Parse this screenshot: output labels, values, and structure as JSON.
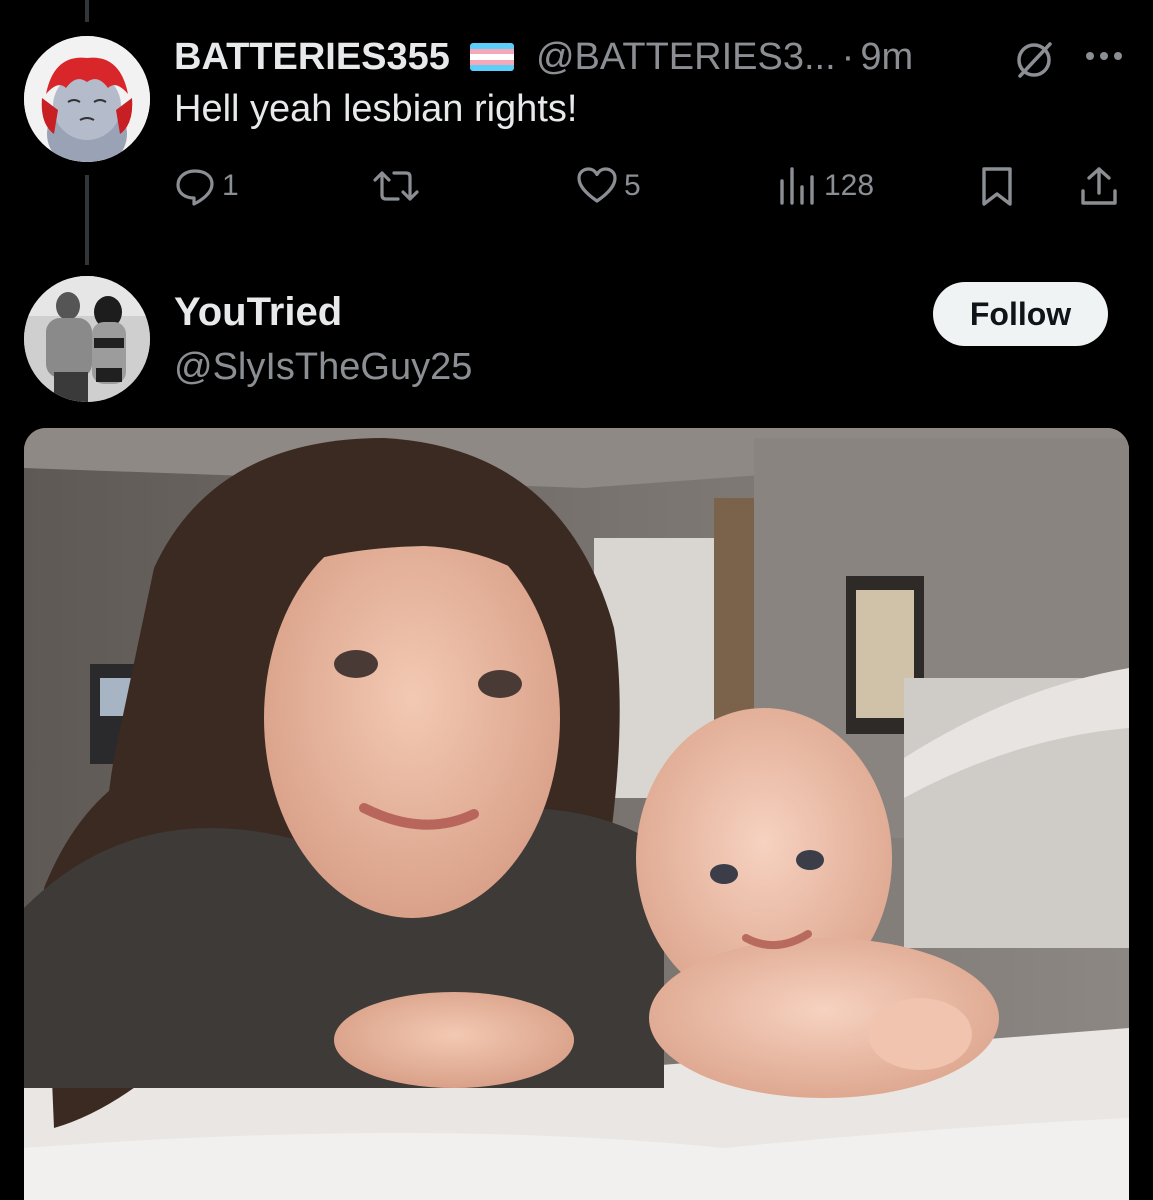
{
  "tweet1": {
    "display_name": "BATTERIES355",
    "handle": "@BATTERIES3...",
    "separator": "·",
    "time": "9m",
    "text": "Hell yeah lesbian rights!",
    "flag_colors": [
      "#5bcefa",
      "#f5a9b8",
      "#ffffff",
      "#f5a9b8",
      "#5bcefa"
    ],
    "actions": {
      "reply_count": "1",
      "retweet_count": "",
      "like_count": "5",
      "views_count": "128"
    },
    "icons": {
      "reply": "reply-icon",
      "retweet": "retweet-icon",
      "like": "heart-icon",
      "views": "views-icon",
      "bookmark": "bookmark-icon",
      "share": "share-icon",
      "muted": "muted-icon",
      "more": "more-icon"
    }
  },
  "tweet2": {
    "display_name": "YouTried",
    "handle": "@SlyIsTheGuy25",
    "follow_label": "Follow"
  },
  "colors": {
    "background": "#000000",
    "text_primary": "#e7e9ea",
    "text_secondary": "#8b8f94",
    "follow_button_bg": "#eff3f4",
    "thread_line": "#333639"
  }
}
